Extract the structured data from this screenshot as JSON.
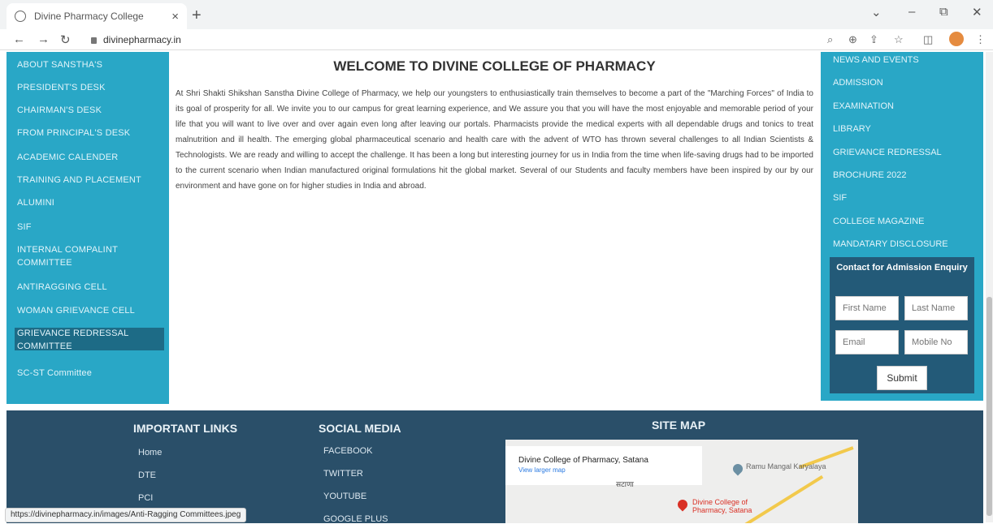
{
  "browser": {
    "tab_title": "Divine Pharmacy College",
    "tab_close": "×",
    "new_tab": "+",
    "url": "divinepharmacy.in",
    "status_url": "https://divinepharmacy.in/images/Anti-Ragging Committees.jpeg"
  },
  "left_nav": [
    "ABOUT SANSTHA'S",
    "PRESIDENT'S DESK",
    "CHAIRMAN'S DESK",
    "FROM PRINCIPAL'S DESK",
    "ACADEMIC CALENDER",
    "TRAINING AND PLACEMENT",
    "ALUMINI",
    "SIF",
    "INTERNAL COMPALINT COMMITTEE",
    "ANTIRAGGING CELL",
    "WOMAN GRIEVANCE CELL",
    "GRIEVANCE REDRESSAL COMMITTEE",
    "SC-ST Committee"
  ],
  "main": {
    "title": "WELCOME TO DIVINE COLLEGE OF PHARMACY",
    "paragraph": "At Shri Shakti Shikshan Sanstha Divine College of Pharmacy, we help our youngsters to enthusiastically train themselves to become a part of the \"Marching Forces\" of India to its goal of prosperity for all. We invite you to our campus for great learning experience, and We assure you that you will have the most enjoyable and memorable period of your life that you will want to live over and over again even long after leaving our portals. Pharmacists provide the medical experts with all dependable drugs and tonics to treat malnutrition and ill health. The emerging global pharmaceutical scenario and health care with the advent of WTO has thrown several challenges to all Indian Scientists & Technologists. We are ready and willing to accept the challenge. It has been a long but interesting journey for us in India from the time when life-saving drugs had to be imported to the current scenario when Indian manufactured original formulations hit the global market. Several of our Students and faculty members have been inspired by our by our environment and have gone on for higher studies in India and abroad."
  },
  "right_nav": [
    "NEWS AND EVENTS",
    "ADMISSION",
    "EXAMINATION",
    "LIBRARY",
    "GRIEVANCE REDRESSAL",
    "BROCHURE 2022",
    "SIF",
    "COLLEGE MAGAZINE",
    "MANDATARY DISCLOSURE"
  ],
  "contact": {
    "title": "Contact for Admission Enquiry",
    "first_name": "First Name",
    "last_name": "Last Name",
    "email": "Email",
    "mobile": "Mobile No",
    "submit": "Submit"
  },
  "footer": {
    "important_links_title": "IMPORTANT LINKS",
    "important_links": [
      "Home",
      "DTE",
      "PCI"
    ],
    "social_title": "SOCIAL MEDIA",
    "social_links": [
      "FACEBOOK",
      "TWITTER",
      "YOUTUBE",
      "GOOGLE PLUS"
    ],
    "sitemap_title": "SITE MAP",
    "map_place": "Divine College of Pharmacy, Satana",
    "map_link": "View larger map",
    "map_pin_label": "Divine College of Pharmacy, Satana",
    "map_place2": "Ramu Mangal Karyalaya",
    "map_town": "सटाणा"
  }
}
